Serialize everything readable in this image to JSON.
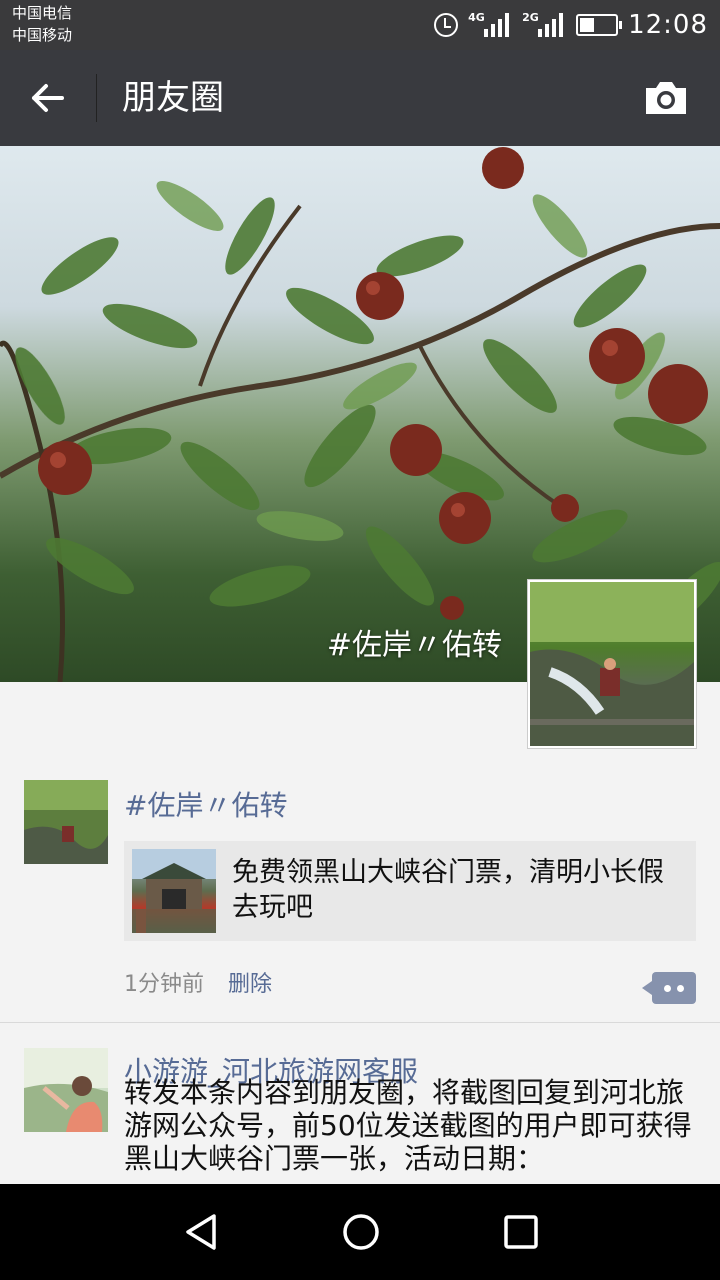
{
  "status_bar": {
    "carrier_1": "中国电信",
    "carrier_2": "中国移动",
    "signal_1": "4G",
    "signal_2": "2G",
    "time": "12:08"
  },
  "title_bar": {
    "title": "朋友圈"
  },
  "cover": {
    "user_name": "#佐岸〃佑转"
  },
  "posts": [
    {
      "name": "#佐岸〃佑转",
      "share_title": "免费领黑山大峡谷门票，清明小长假去玩吧",
      "time": "1分钟前",
      "delete_label": "删除"
    },
    {
      "name": "小游游_河北旅游网客服",
      "text": "转发本条内容到朋友圈，将截图回复到河北旅游网公众号，前50位发送截图的用户即可获得黑山大峡谷门票一张，活动日期："
    }
  ],
  "colors": {
    "title_bar_bg": "#393a3f",
    "link_blue": "#576b95",
    "content_bg": "#f3f3f3"
  }
}
